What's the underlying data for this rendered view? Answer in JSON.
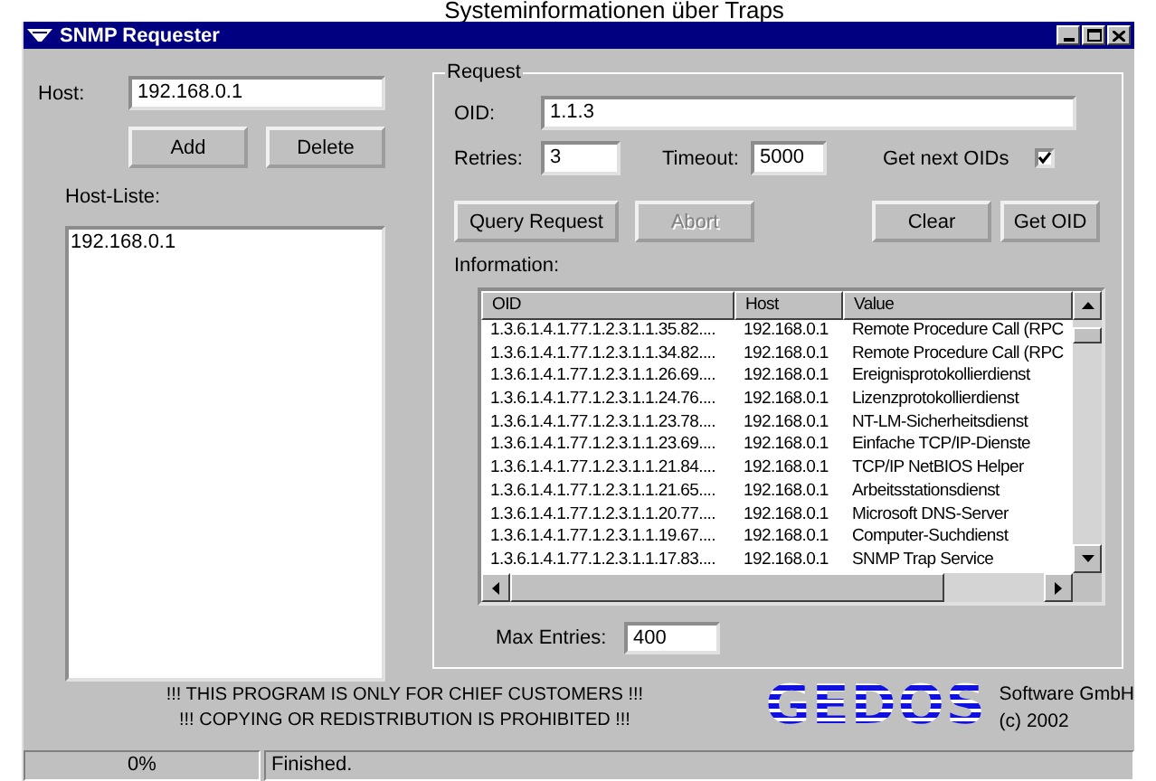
{
  "caption": "Systeminformationen über Traps",
  "window": {
    "title": "SNMP Requester"
  },
  "host": {
    "label": "Host:",
    "value": "192.168.0.1"
  },
  "host_buttons": [
    {
      "label": "Add",
      "disabled": false
    },
    {
      "label": "Delete",
      "disabled": false
    }
  ],
  "host_list": {
    "label": "Host-Liste:",
    "items": [
      {
        "text": "192.168.0.1",
        "selected": false
      }
    ]
  },
  "request": {
    "title": "Request",
    "oid": {
      "label": "OID:",
      "value": "1.1.3"
    },
    "retries": {
      "label": "Retries:",
      "value": "3"
    },
    "timeout": {
      "label": "Timeout:",
      "value": "5000"
    },
    "get_next": {
      "label": "Get next OIDs",
      "checked": true
    },
    "buttons": [
      {
        "label": "Query Request",
        "disabled": false
      },
      {
        "label": "Abort",
        "disabled": true
      },
      {
        "label": "Clear",
        "disabled": false
      },
      {
        "label": "Get OID",
        "disabled": false
      }
    ],
    "information_label": "Information:",
    "table": {
      "columns": [
        "OID",
        "Host",
        "Value"
      ],
      "rows": [
        {
          "cells": [
            "1.3.6.1.4.1.77.1.2.3.1.1.35.82....",
            "192.168.0.1",
            "Remote Procedure Call (RPC"
          ],
          "selected": false
        },
        {
          "cells": [
            "1.3.6.1.4.1.77.1.2.3.1.1.34.82....",
            "192.168.0.1",
            "Remote Procedure Call (RPC"
          ],
          "selected": false
        },
        {
          "cells": [
            "1.3.6.1.4.1.77.1.2.3.1.1.26.69....",
            "192.168.0.1",
            "Ereignisprotokollierdienst"
          ],
          "selected": false
        },
        {
          "cells": [
            "1.3.6.1.4.1.77.1.2.3.1.1.24.76....",
            "192.168.0.1",
            "Lizenzprotokollierdienst"
          ],
          "selected": false
        },
        {
          "cells": [
            "1.3.6.1.4.1.77.1.2.3.1.1.23.78....",
            "192.168.0.1",
            "NT-LM-Sicherheitsdienst"
          ],
          "selected": false
        },
        {
          "cells": [
            "1.3.6.1.4.1.77.1.2.3.1.1.23.69....",
            "192.168.0.1",
            "Einfache TCP/IP-Dienste"
          ],
          "selected": false
        },
        {
          "cells": [
            "1.3.6.1.4.1.77.1.2.3.1.1.21.84....",
            "192.168.0.1",
            "TCP/IP NetBIOS Helper"
          ],
          "selected": false
        },
        {
          "cells": [
            "1.3.6.1.4.1.77.1.2.3.1.1.21.65....",
            "192.168.0.1",
            "Arbeitsstationsdienst"
          ],
          "selected": false
        },
        {
          "cells": [
            "1.3.6.1.4.1.77.1.2.3.1.1.20.77....",
            "192.168.0.1",
            "Microsoft DNS-Server"
          ],
          "selected": false
        },
        {
          "cells": [
            "1.3.6.1.4.1.77.1.2.3.1.1.19.67....",
            "192.168.0.1",
            "Computer-Suchdienst"
          ],
          "selected": false
        },
        {
          "cells": [
            "1.3.6.1.4.1.77.1.2.3.1.1.17.83....",
            "192.168.0.1",
            "SNMP Trap Service"
          ],
          "selected": false
        }
      ]
    },
    "max_entries": {
      "label": "Max Entries:",
      "value": "400"
    }
  },
  "notices": [
    "!!! THIS PROGRAM IS ONLY FOR CHIEF CUSTOMERS !!!",
    "!!! COPYING OR REDISTRIBUTION IS PROHIBITED !!!"
  ],
  "logo": {
    "text": "GEDOS",
    "company": "Software GmbH",
    "copyright": "(c) 2002"
  },
  "status_bar": [
    "0%",
    "Finished."
  ]
}
